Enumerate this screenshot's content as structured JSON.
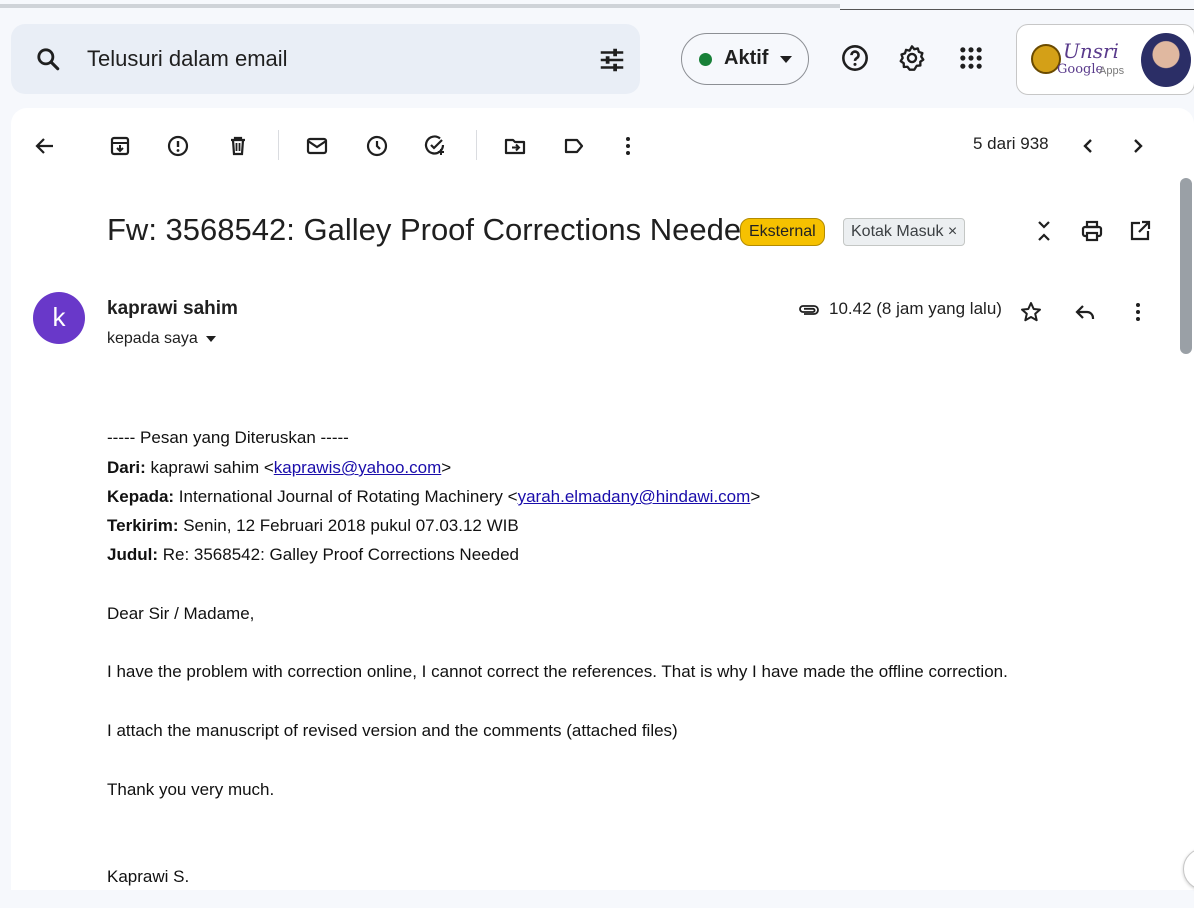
{
  "search": {
    "placeholder": "Telusuri dalam email"
  },
  "status": {
    "label": "Aktif",
    "color": "#188038"
  },
  "account": {
    "brand_line1": "Unsri",
    "brand_line2": "Google",
    "brand_line3": "Apps"
  },
  "toolbar": {
    "counter": "5 dari 938"
  },
  "email": {
    "subject": "Fw: 3568542: Galley Proof Corrections Needed",
    "badge_external": "Eksternal",
    "badge_inbox": "Kotak Masuk ×",
    "avatar_letter": "k",
    "sender": "kaprawi sahim",
    "to_me": "kepada saya",
    "time": "10.42 (8 jam yang lalu)",
    "body": {
      "forward_header": "----- Pesan yang Diteruskan -----",
      "from_label": "Dari:",
      "from_name": " kaprawi sahim <",
      "from_email": "kaprawis@yahoo.com",
      "from_close": ">",
      "to_label": "Kepada:",
      "to_name": " International Journal of Rotating Machinery <",
      "to_email": "yarah.elmadany@hindawi.com",
      "to_close": ">",
      "sent_label": "Terkirim:",
      "sent_value": " Senin, 12 Februari 2018 pukul 07.03.12 WIB",
      "subject_label": "Judul:",
      "subject_value": " Re: 3568542: Galley Proof Corrections Needed",
      "greeting": "Dear Sir / Madame,",
      "para1": "I have the problem with correction online, I cannot correct the references. That is why I have made the offline correction.",
      "para2": "I attach the manuscript of revised version and the comments (attached files)",
      "para3": "Thank you very much.",
      "signature": "Kaprawi S."
    }
  }
}
